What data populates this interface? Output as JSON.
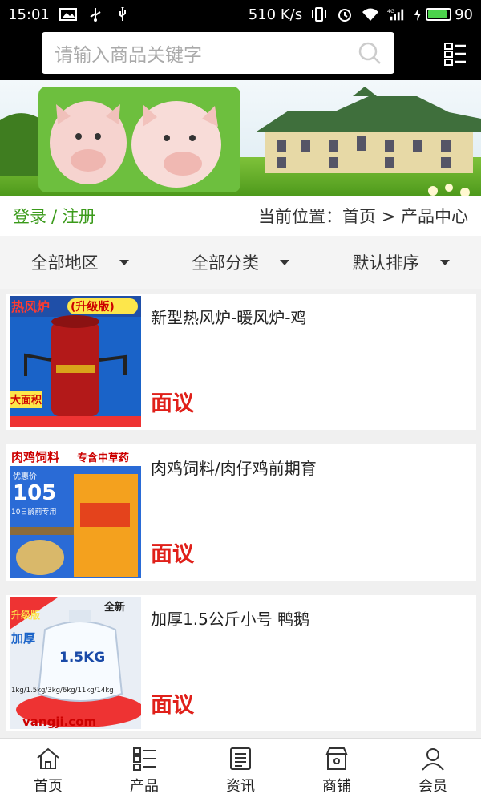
{
  "status_bar": {
    "time": "15:01",
    "net_speed": "510 K/s",
    "network_type": "4G",
    "battery": "90",
    "battery_level": 0.9,
    "icons": [
      "image-icon",
      "usb-icon",
      "vibrate-icon",
      "alarm-icon",
      "wifi-icon",
      "signal-icon",
      "charging-icon"
    ]
  },
  "search": {
    "placeholder": "请输入商品关键字",
    "icon": "search-icon"
  },
  "menu_icon": "list-menu-icon",
  "account": {
    "login": "登录",
    "separator": "/",
    "register": "注册"
  },
  "location": {
    "prefix": "当前位置：",
    "home": "首页",
    "arrow": ">",
    "current": "产品中心"
  },
  "filters": [
    {
      "label": "全部地区"
    },
    {
      "label": "全部分类"
    },
    {
      "label": "默认排序"
    }
  ],
  "products": [
    {
      "title": "新型热风炉-暖风炉-鸡",
      "price": "面议",
      "thumb_text": [
        "热风炉",
        "(升级版)",
        "大面积"
      ]
    },
    {
      "title": "肉鸡饲料/肉仔鸡前期育",
      "price": "面议",
      "thumb_text": [
        "肉鸡饲料",
        "专含中草药",
        "优惠价",
        "105",
        "10日龄前专用"
      ]
    },
    {
      "title": "加厚1.5公斤小号 鸭鹅",
      "price": "面议",
      "thumb_text": [
        "升级版",
        "全新",
        "加厚",
        "1.5KG",
        "1kg/1.5kg/3kg/6kg/11kg/14kg",
        "vangji.com"
      ]
    }
  ],
  "tabs": [
    {
      "label": "首页",
      "icon": "home-icon"
    },
    {
      "label": "产品",
      "icon": "product-list-icon"
    },
    {
      "label": "资讯",
      "icon": "news-icon"
    },
    {
      "label": "商铺",
      "icon": "shop-icon"
    },
    {
      "label": "会员",
      "icon": "member-icon"
    }
  ],
  "colors": {
    "login_green": "#3a9a1a",
    "price_red": "#e0201a"
  }
}
